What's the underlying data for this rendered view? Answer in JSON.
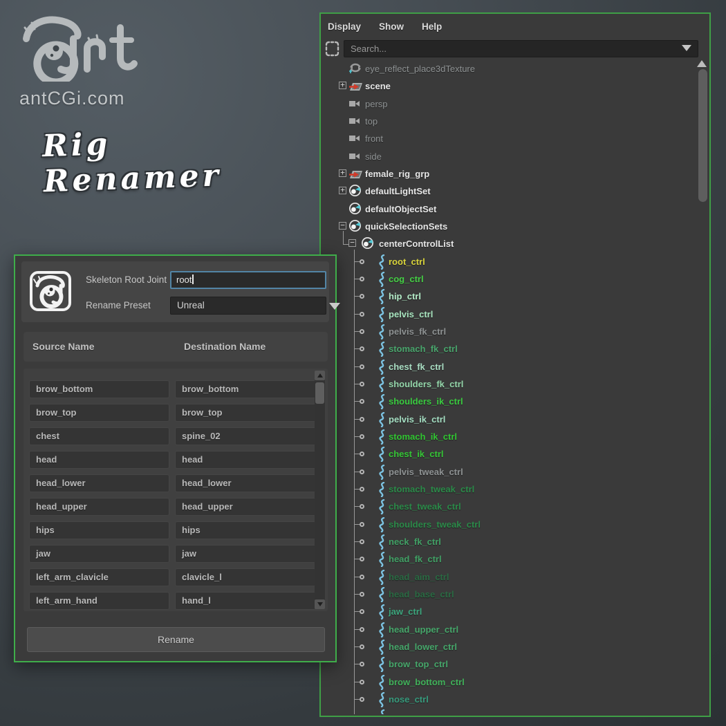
{
  "branding": {
    "site": "antCGi.com",
    "tagline": "Rig Renamer",
    "logo_name": "antcgi-ant-logo"
  },
  "renamer": {
    "fields": [
      {
        "label": "Skeleton Root Joint",
        "value": "root"
      },
      {
        "label": "Rename Preset",
        "value": "Unreal"
      }
    ],
    "columns": [
      "Source Name",
      "Destination Name"
    ],
    "rows": [
      {
        "source": "brow_bottom",
        "dest": "brow_bottom"
      },
      {
        "source": "brow_top",
        "dest": "brow_top"
      },
      {
        "source": "chest",
        "dest": "spine_02"
      },
      {
        "source": "head",
        "dest": "head"
      },
      {
        "source": "head_lower",
        "dest": "head_lower"
      },
      {
        "source": "head_upper",
        "dest": "head_upper"
      },
      {
        "source": "hips",
        "dest": "hips"
      },
      {
        "source": "jaw",
        "dest": "jaw"
      },
      {
        "source": "left_arm_clavicle",
        "dest": "clavicle_l"
      },
      {
        "source": "left_arm_hand",
        "dest": "hand_l"
      }
    ],
    "button_label": "Rename"
  },
  "outliner": {
    "menus": [
      "Display",
      "Show",
      "Help"
    ],
    "search_placeholder": "Search...",
    "tree": [
      {
        "label": "eye_reflect_place3dTexture",
        "icon": "place3d-texture",
        "style": "dim",
        "indent": 1
      },
      {
        "label": "scene",
        "icon": "transform",
        "style": "bold",
        "indent": 1,
        "expand": "plus"
      },
      {
        "label": "persp",
        "icon": "camera",
        "style": "dim",
        "indent": 1
      },
      {
        "label": "top",
        "icon": "camera",
        "style": "dim",
        "indent": 1
      },
      {
        "label": "front",
        "icon": "camera",
        "style": "dim",
        "indent": 1
      },
      {
        "label": "side",
        "icon": "camera",
        "style": "dim",
        "indent": 1
      },
      {
        "label": "female_rig_grp",
        "icon": "transform",
        "style": "bold",
        "indent": 1,
        "expand": "plus"
      },
      {
        "label": "defaultLightSet",
        "icon": "set",
        "style": "bold",
        "indent": 1,
        "expand": "plus"
      },
      {
        "label": "defaultObjectSet",
        "icon": "set",
        "style": "bold",
        "indent": 1
      },
      {
        "label": "quickSelectionSets",
        "icon": "set",
        "style": "bold",
        "indent": 1,
        "expand": "minus"
      },
      {
        "label": "centerControlList",
        "icon": "set",
        "style": "bold",
        "indent": 2,
        "expand": "minus"
      },
      {
        "label": "root_ctrl",
        "icon": "curve",
        "color": "#d9d43b"
      },
      {
        "label": "cog_ctrl",
        "icon": "curve",
        "color": "#45cf45"
      },
      {
        "label": "hip_ctrl",
        "icon": "curve",
        "color": "#b4ecc8"
      },
      {
        "label": "pelvis_ctrl",
        "icon": "curve",
        "color": "#a9e6c0"
      },
      {
        "label": "pelvis_fk_ctrl",
        "icon": "curve",
        "color": "#8d9192"
      },
      {
        "label": "stomach_fk_ctrl",
        "icon": "curve",
        "color": "#49a56c"
      },
      {
        "label": "chest_fk_ctrl",
        "icon": "curve",
        "color": "#abdfc4"
      },
      {
        "label": "shoulders_fk_ctrl",
        "icon": "curve",
        "color": "#94d6aa"
      },
      {
        "label": "shoulders_ik_ctrl",
        "icon": "curve",
        "color": "#3acb40"
      },
      {
        "label": "pelvis_ik_ctrl",
        "icon": "curve",
        "color": "#a5dfc3"
      },
      {
        "label": "stomach_ik_ctrl",
        "icon": "curve",
        "color": "#31c532"
      },
      {
        "label": "chest_ik_ctrl",
        "icon": "curve",
        "color": "#35c636"
      },
      {
        "label": "pelvis_tweak_ctrl",
        "icon": "curve",
        "color": "#8d9192"
      },
      {
        "label": "stomach_tweak_ctrl",
        "icon": "curve",
        "color": "#2b8a49"
      },
      {
        "label": "chest_tweak_ctrl",
        "icon": "curve",
        "color": "#2b8a49"
      },
      {
        "label": "shoulders_tweak_ctrl",
        "icon": "curve",
        "color": "#2b8a49"
      },
      {
        "label": "neck_fk_ctrl",
        "icon": "curve",
        "color": "#41a065"
      },
      {
        "label": "head_fk_ctrl",
        "icon": "curve",
        "color": "#41a065"
      },
      {
        "label": "head_aim_ctrl",
        "icon": "curve",
        "color": "#2a6a43"
      },
      {
        "label": "head_base_ctrl",
        "icon": "curve",
        "color": "#2a6a43"
      },
      {
        "label": "jaw_ctrl",
        "icon": "curve",
        "color": "#3ca67d"
      },
      {
        "label": "head_upper_ctrl",
        "icon": "curve",
        "color": "#46a66a"
      },
      {
        "label": "head_lower_ctrl",
        "icon": "curve",
        "color": "#46a66a"
      },
      {
        "label": "brow_top_ctrl",
        "icon": "curve",
        "color": "#46a66a"
      },
      {
        "label": "brow_bottom_ctrl",
        "icon": "curve",
        "color": "#41b15a"
      },
      {
        "label": "nose_ctrl",
        "icon": "curve",
        "color": "#379a7c"
      },
      {
        "label": "",
        "icon": "curve",
        "color": "#7cc3e2"
      }
    ]
  },
  "colors": {
    "panel_border_green": "#3f9f46",
    "focus_blue": "#5285a6",
    "panel_bg": "#3a3a3a",
    "curve_icon_blue": "#7cc3e2"
  }
}
